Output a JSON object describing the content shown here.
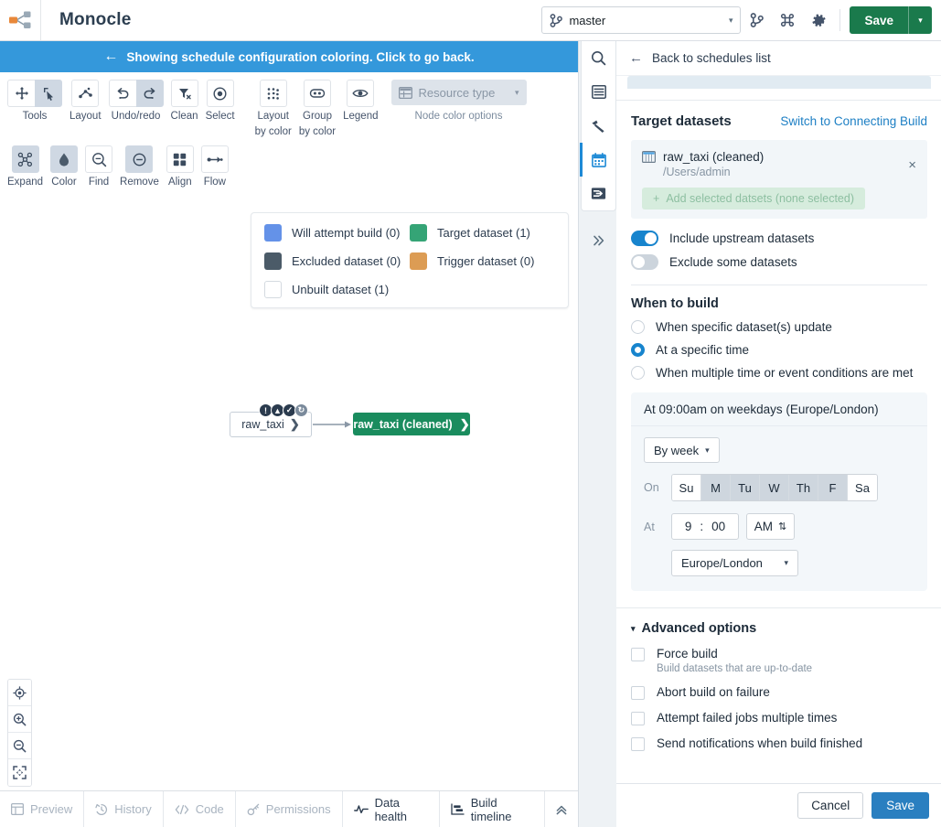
{
  "header": {
    "app_title": "Monocle",
    "logo_icon": "graph-node-logo-icon",
    "branch": {
      "icon": "branch-icon",
      "value": "master",
      "caret": "▾"
    },
    "icons": [
      {
        "name": "branch-icon",
        "label": "branches"
      },
      {
        "name": "command-icon",
        "label": "commands"
      },
      {
        "name": "gear-icon",
        "label": "settings"
      }
    ],
    "save_label": "Save",
    "save_caret": "▾"
  },
  "banner": {
    "arrow": "←",
    "text": "Showing schedule configuration coloring. Click to go back."
  },
  "toolbar": {
    "groups": [
      {
        "name": "tools",
        "label": "Tools",
        "buttons": [
          {
            "icon": "move-icon",
            "active": false
          },
          {
            "icon": "select-cursor-icon",
            "active": true
          }
        ]
      },
      {
        "name": "layout",
        "label": "Layout",
        "buttons": [
          {
            "icon": "layout-graph-icon",
            "active": false
          }
        ]
      },
      {
        "name": "undo",
        "label": "Undo/redo",
        "buttons": [
          {
            "icon": "undo-icon",
            "active": false
          },
          {
            "icon": "redo-icon",
            "active": true
          }
        ]
      },
      {
        "name": "clean",
        "label": "Clean",
        "buttons": [
          {
            "icon": "filter-remove-icon",
            "active": false
          }
        ]
      },
      {
        "name": "select",
        "label": "Select",
        "buttons": [
          {
            "icon": "target-dot-icon",
            "active": false
          }
        ]
      }
    ],
    "groups2": [
      {
        "name": "expand",
        "label": "Expand",
        "buttons": [
          {
            "icon": "expand-nodes-icon",
            "active": true
          }
        ]
      },
      {
        "name": "color",
        "label": "Color",
        "buttons": [
          {
            "icon": "droplet-icon",
            "active": true
          }
        ]
      },
      {
        "name": "find",
        "label": "Find",
        "buttons": [
          {
            "icon": "search-zoom-icon",
            "active": false
          }
        ]
      },
      {
        "name": "remove",
        "label": "Remove",
        "buttons": [
          {
            "icon": "minus-circle-icon",
            "active": true
          }
        ]
      },
      {
        "name": "align",
        "label": "Align",
        "buttons": [
          {
            "icon": "grid-squares-icon",
            "active": false
          }
        ]
      },
      {
        "name": "flow",
        "label": "Flow",
        "buttons": [
          {
            "icon": "flow-arrow-icon",
            "active": false
          }
        ]
      }
    ],
    "color_group": [
      {
        "name": "layout-by-color",
        "label_line1": "Layout",
        "label_line2": "by color",
        "icon": "dots-layout-icon"
      },
      {
        "name": "group-by-color",
        "label_line1": "Group",
        "label_line2": "by color",
        "icon": "group-oval-icon"
      },
      {
        "name": "legend",
        "label_line1": "Legend",
        "label_line2": "",
        "icon": "eye-icon"
      }
    ],
    "resource_type": {
      "icon": "table-icon",
      "label": "Resource type",
      "caret": "▾",
      "group_label": "Node color options"
    }
  },
  "legend": {
    "items": [
      {
        "label": "Will attempt build (0)",
        "color": "#6492e8"
      },
      {
        "label": "Target dataset (1)",
        "color": "#35a476"
      },
      {
        "label": "Excluded dataset (0)",
        "color": "#4b5b68"
      },
      {
        "label": "Trigger dataset (0)",
        "color": "#dc9c54"
      },
      {
        "label": "Unbuilt dataset (1)",
        "color": ""
      }
    ]
  },
  "graph": {
    "source_node": {
      "label": "raw_taxi",
      "chevron": "❯"
    },
    "source_badges": [
      {
        "name": "info-badge",
        "glyph": "!"
      },
      {
        "name": "upload-badge",
        "glyph": "▲"
      },
      {
        "name": "check-badge",
        "glyph": "✓"
      },
      {
        "name": "sync-badge",
        "glyph": "↻"
      }
    ],
    "target_node": {
      "label": "raw_taxi (cleaned)",
      "chevron": "❯"
    }
  },
  "zoom_controls": [
    {
      "name": "recenter-icon"
    },
    {
      "name": "zoom-in-icon"
    },
    {
      "name": "zoom-out-icon"
    },
    {
      "name": "fit-to-screen-icon"
    }
  ],
  "bottom_bar": {
    "items": [
      {
        "label": "Preview",
        "icon": "table-preview-icon",
        "disabled": true
      },
      {
        "label": "History",
        "icon": "history-clock-icon",
        "disabled": true
      },
      {
        "label": "Code",
        "icon": "code-brackets-icon",
        "disabled": true
      },
      {
        "label": "Permissions",
        "icon": "key-icon",
        "disabled": true
      },
      {
        "label": "Data health",
        "icon": "pulse-icon",
        "disabled": false
      },
      {
        "label": "Build timeline",
        "icon": "timeline-icon",
        "disabled": false
      }
    ],
    "collapse_icon": "chevrons-up-icon"
  },
  "rail": {
    "items": [
      {
        "name": "rail-search",
        "icon": "search-icon",
        "selected": false
      },
      {
        "name": "rail-list",
        "icon": "list-icon",
        "selected": false
      },
      {
        "name": "rail-build",
        "icon": "hammer-icon",
        "selected": false
      },
      {
        "name": "rail-schedules",
        "icon": "calendar-icon",
        "selected": true
      },
      {
        "name": "rail-import",
        "icon": "import-icon",
        "selected": false
      }
    ],
    "expand_icon": "chevrons-right-icon"
  },
  "panel": {
    "back_arrow": "←",
    "back_label": "Back to schedules list",
    "target_datasets": {
      "title": "Target datasets",
      "switch_link": "Switch to Connecting Build",
      "dataset": {
        "icon": "dataset-table-icon",
        "name": "raw_taxi (cleaned)",
        "path": "/Users/admin",
        "remove_icon": "×"
      },
      "add_button": {
        "plus": "+",
        "label": "Add selected datsets (none selected)"
      },
      "toggles": [
        {
          "label": "Include upstream datasets",
          "on": true
        },
        {
          "label": "Exclude some datasets",
          "on": false
        }
      ]
    },
    "when_to_build": {
      "title": "When to build",
      "options": [
        {
          "label": "When specific dataset(s) update",
          "selected": false
        },
        {
          "label": "At a specific time",
          "selected": true
        },
        {
          "label": "When multiple time or event conditions are met",
          "selected": false
        }
      ]
    },
    "schedule": {
      "summary": "At 09:00am on weekdays (Europe/London)",
      "frequency": {
        "label": "By week",
        "caret": "▾"
      },
      "on_label": "On",
      "days": [
        {
          "label": "Su",
          "selected": false
        },
        {
          "label": "M",
          "selected": true
        },
        {
          "label": "Tu",
          "selected": true
        },
        {
          "label": "W",
          "selected": true
        },
        {
          "label": "Th",
          "selected": true
        },
        {
          "label": "F",
          "selected": true
        },
        {
          "label": "Sa",
          "selected": false
        }
      ],
      "at_label": "At",
      "hour": "9",
      "time_sep": ":",
      "minute": "00",
      "ampm": "AM",
      "ampm_stepper": "⇅",
      "timezone": "Europe/London",
      "timezone_caret": "▾"
    },
    "advanced": {
      "triangle": "▾",
      "title": "Advanced options",
      "items": [
        {
          "label": "Force build",
          "sub": "Build datasets that are up-to-date",
          "checked": false
        },
        {
          "label": "Abort build on failure",
          "sub": "",
          "checked": false
        },
        {
          "label": "Attempt failed jobs multiple times",
          "sub": "",
          "checked": false
        },
        {
          "label": "Send notifications when build finished",
          "sub": "",
          "checked": false
        }
      ]
    },
    "footer": {
      "cancel": "Cancel",
      "save": "Save"
    }
  },
  "colors": {
    "accent_blue": "#1784cd",
    "banner_blue": "#3498db",
    "save_green": "#1a7a4c",
    "target_green": "#1a8c5e"
  }
}
